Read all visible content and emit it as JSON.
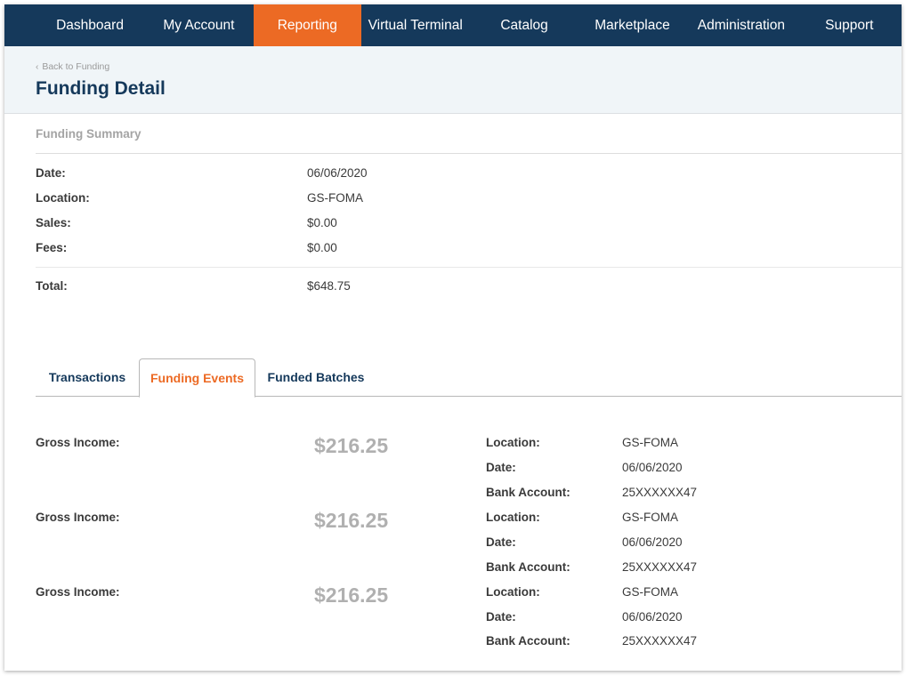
{
  "nav": {
    "items": [
      {
        "label": "Dashboard",
        "active": false
      },
      {
        "label": "My Account",
        "active": false
      },
      {
        "label": "Reporting",
        "active": true
      },
      {
        "label": "Virtual Terminal",
        "active": false
      },
      {
        "label": "Catalog",
        "active": false
      },
      {
        "label": "Marketplace",
        "active": false
      },
      {
        "label": "Administration",
        "active": false
      },
      {
        "label": "Support",
        "active": false
      }
    ]
  },
  "colors": {
    "nav_bg": "#15395b",
    "accent": "#ec6a24",
    "header_bg": "#f0f5f8",
    "title": "#15395b"
  },
  "header": {
    "back_icon": "chevron-left-icon",
    "back_label": "Back to Funding",
    "title": "Funding Detail"
  },
  "summary": {
    "title": "Funding Summary",
    "rows": [
      {
        "label": "Date:",
        "value": "06/06/2020"
      },
      {
        "label": "Location:",
        "value": "GS-FOMA"
      },
      {
        "label": "Sales:",
        "value": "$0.00"
      },
      {
        "label": "Fees:",
        "value": "$0.00"
      }
    ],
    "total": {
      "label": "Total:",
      "value": "$648.75"
    }
  },
  "tabs": [
    {
      "label": "Transactions",
      "active": false
    },
    {
      "label": "Funding Events",
      "active": true
    },
    {
      "label": "Funded Batches",
      "active": false
    }
  ],
  "events": [
    {
      "gross_label": "Gross Income:",
      "gross_amount": "$216.25",
      "details": [
        {
          "label": "Location:",
          "value": "GS-FOMA"
        },
        {
          "label": "Date:",
          "value": "06/06/2020"
        },
        {
          "label": "Bank Account:",
          "value": "25XXXXXX47"
        }
      ]
    },
    {
      "gross_label": "Gross Income:",
      "gross_amount": "$216.25",
      "details": [
        {
          "label": "Location:",
          "value": "GS-FOMA"
        },
        {
          "label": "Date:",
          "value": "06/06/2020"
        },
        {
          "label": "Bank Account:",
          "value": "25XXXXXX47"
        }
      ]
    },
    {
      "gross_label": "Gross Income:",
      "gross_amount": "$216.25",
      "details": [
        {
          "label": "Location:",
          "value": "GS-FOMA"
        },
        {
          "label": "Date:",
          "value": "06/06/2020"
        },
        {
          "label": "Bank Account:",
          "value": "25XXXXXX47"
        }
      ]
    }
  ]
}
